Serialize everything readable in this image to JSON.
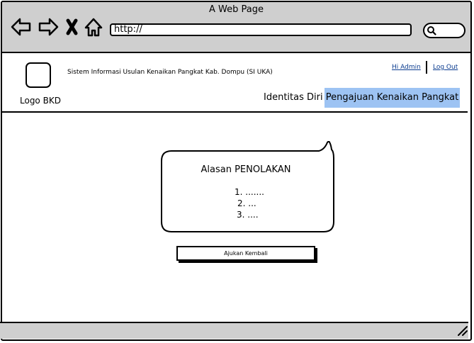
{
  "browser": {
    "window_title": "A Web Page",
    "url": "http://",
    "icons": [
      "back-arrow-icon",
      "forward-arrow-icon",
      "close-x-icon",
      "home-icon",
      "search-icon",
      "resize-grip-icon"
    ]
  },
  "header": {
    "logo_label": "Logo BKD",
    "app_title": "Sistem Informasi Usulan Kenaikan Pangkat Kab. Dompu (SI UKA)",
    "admin_link": "Hi Admin",
    "logout_link": "Log Out"
  },
  "tabs": [
    {
      "label": "Identitas Diri",
      "active": false
    },
    {
      "label": "Pengajuan Kenaikan Pangkat",
      "active": true
    }
  ],
  "rejection": {
    "title": "Alasan PENOLAKAN",
    "reasons": [
      "1. .......",
      "2. ...",
      "3. ...."
    ]
  },
  "actions": {
    "resubmit_label": "Ajukan Kembali"
  },
  "colors": {
    "chrome_gray": "#cfcfcf",
    "active_tab": "#9dc3f3",
    "link": "#0b3c8f"
  }
}
